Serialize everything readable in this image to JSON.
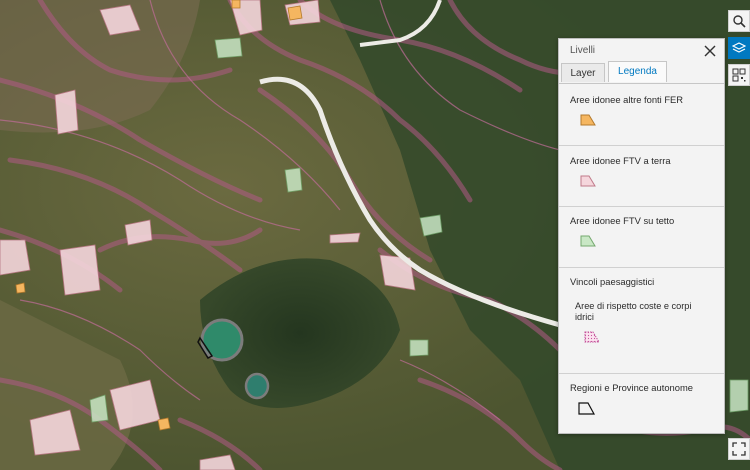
{
  "panel": {
    "title": "Livelli",
    "tabs": [
      {
        "label": "Layer",
        "active": false
      },
      {
        "label": "Legenda",
        "active": true
      }
    ],
    "legend": [
      {
        "title": "Aree idonee altre fonti FER",
        "symbol": "polygon",
        "fill": "#f5b660",
        "stroke": "#b47a2c"
      },
      {
        "title": "Aree idonee FTV a terra",
        "symbol": "polygon",
        "fill": "#f5d6dc",
        "stroke": "#c07a8a"
      },
      {
        "title": "Aree idonee FTV su tetto",
        "symbol": "polygon",
        "fill": "#c9e7c5",
        "stroke": "#74a86e"
      },
      {
        "title": "Vincoli paesaggistici",
        "sub_label": "Aree di rispetto coste e corpi idrici",
        "symbol": "dotted-polygon",
        "fill": "#fbe2ef",
        "stroke": "#c4529a"
      },
      {
        "title": "Regioni e Province autonome",
        "symbol": "outline-polygon",
        "fill": "none",
        "stroke": "#111111"
      }
    ]
  },
  "controls": [
    {
      "name": "search",
      "icon": "search-icon",
      "active": false
    },
    {
      "name": "layers",
      "icon": "layers-icon",
      "active": true
    },
    {
      "name": "qr",
      "icon": "qr-icon",
      "active": false
    },
    {
      "name": "fullscreen",
      "icon": "fullscreen-icon",
      "active": false
    }
  ],
  "colors": {
    "accent": "#0079c1",
    "map_base": "#3d4a2c",
    "lake": "#2f8a6a",
    "highway": "#e9e6e1",
    "fer": "#f5b660",
    "ftv_terra": "#f5d6dc",
    "ftv_tetto": "#c9e7c5",
    "vincoli": "#b15a86"
  }
}
